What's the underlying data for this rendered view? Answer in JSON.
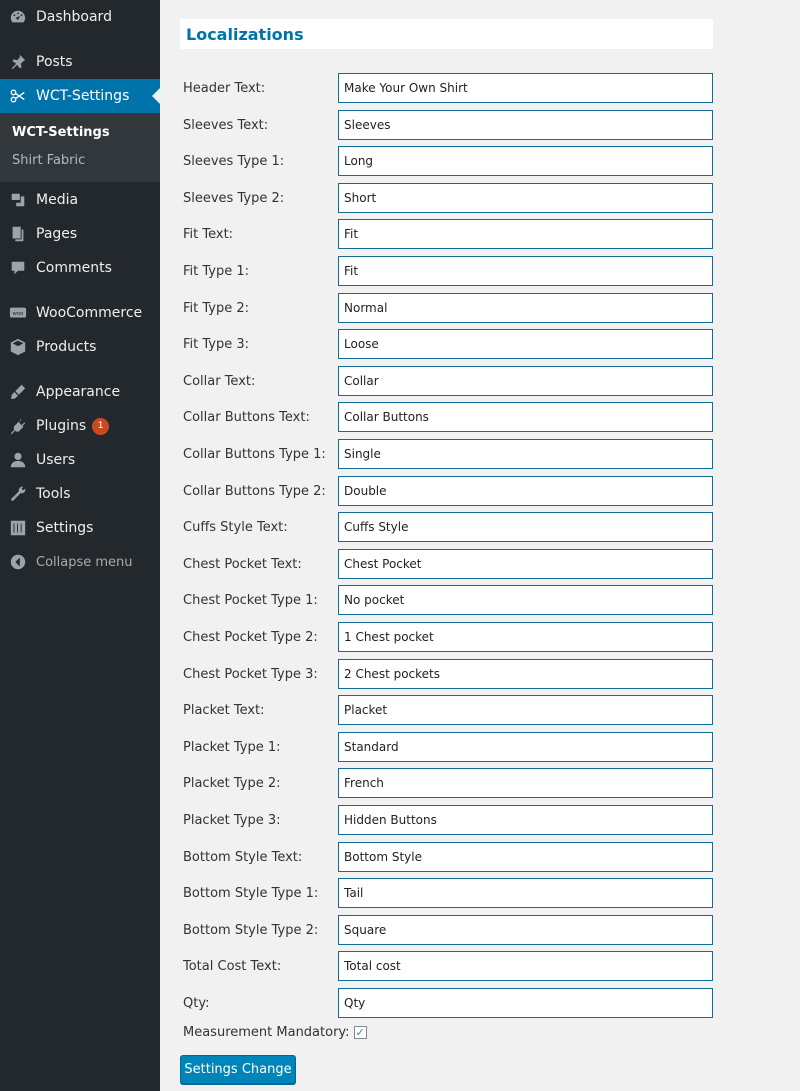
{
  "sidebar": {
    "items": [
      {
        "label": "Dashboard",
        "icon": "dashboard-icon"
      },
      {
        "label": "Posts",
        "icon": "pin-icon"
      },
      {
        "label": "WCT-Settings",
        "icon": "scissors-icon"
      },
      {
        "label": "Media",
        "icon": "media-icon"
      },
      {
        "label": "Pages",
        "icon": "pages-icon"
      },
      {
        "label": "Comments",
        "icon": "comment-icon"
      },
      {
        "label": "WooCommerce",
        "icon": "woocommerce-icon"
      },
      {
        "label": "Products",
        "icon": "box-icon"
      },
      {
        "label": "Appearance",
        "icon": "brush-icon"
      },
      {
        "label": "Plugins",
        "icon": "plugin-icon",
        "badge": "1"
      },
      {
        "label": "Users",
        "icon": "user-icon"
      },
      {
        "label": "Tools",
        "icon": "wrench-icon"
      },
      {
        "label": "Settings",
        "icon": "sliders-icon"
      }
    ],
    "submenu": [
      "WCT-Settings",
      "Shirt Fabric"
    ],
    "collapse_label": "Collapse menu",
    "accent": "#0073aa"
  },
  "page": {
    "title": "Localizations",
    "fields": [
      {
        "label": "Header Text:",
        "value": "Make Your Own Shirt"
      },
      {
        "label": "Sleeves Text:",
        "value": "Sleeves"
      },
      {
        "label": "Sleeves Type 1:",
        "value": "Long"
      },
      {
        "label": "Sleeves Type 2:",
        "value": "Short"
      },
      {
        "label": "Fit Text:",
        "value": "Fit"
      },
      {
        "label": "Fit Type 1:",
        "value": "Fit"
      },
      {
        "label": "Fit Type 2:",
        "value": "Normal"
      },
      {
        "label": "Fit Type 3:",
        "value": "Loose"
      },
      {
        "label": "Collar Text:",
        "value": "Collar"
      },
      {
        "label": "Collar Buttons Text:",
        "value": "Collar Buttons"
      },
      {
        "label": "Collar Buttons Type 1:",
        "value": "Single"
      },
      {
        "label": "Collar Buttons Type 2:",
        "value": "Double"
      },
      {
        "label": "Cuffs Style Text:",
        "value": "Cuffs Style"
      },
      {
        "label": "Chest Pocket Text:",
        "value": "Chest Pocket"
      },
      {
        "label": "Chest Pocket Type 1:",
        "value": "No pocket"
      },
      {
        "label": "Chest Pocket Type 2:",
        "value": "1 Chest pocket"
      },
      {
        "label": "Chest Pocket Type 3:",
        "value": "2 Chest pockets"
      },
      {
        "label": "Placket Text:",
        "value": "Placket"
      },
      {
        "label": "Placket Type 1:",
        "value": "Standard"
      },
      {
        "label": "Placket Type 2:",
        "value": "French"
      },
      {
        "label": "Placket Type 3:",
        "value": "Hidden Buttons"
      },
      {
        "label": "Bottom Style Text:",
        "value": "Bottom Style"
      },
      {
        "label": "Bottom Style Type 1:",
        "value": "Tail"
      },
      {
        "label": "Bottom Style Type 2:",
        "value": "Square"
      },
      {
        "label": "Total Cost Text:",
        "value": "Total cost"
      },
      {
        "label": "Qty:",
        "value": "Qty"
      }
    ],
    "mandatory_label": "Measurement Mandatory:",
    "mandatory_checked": true,
    "save_label": "Settings Change"
  }
}
